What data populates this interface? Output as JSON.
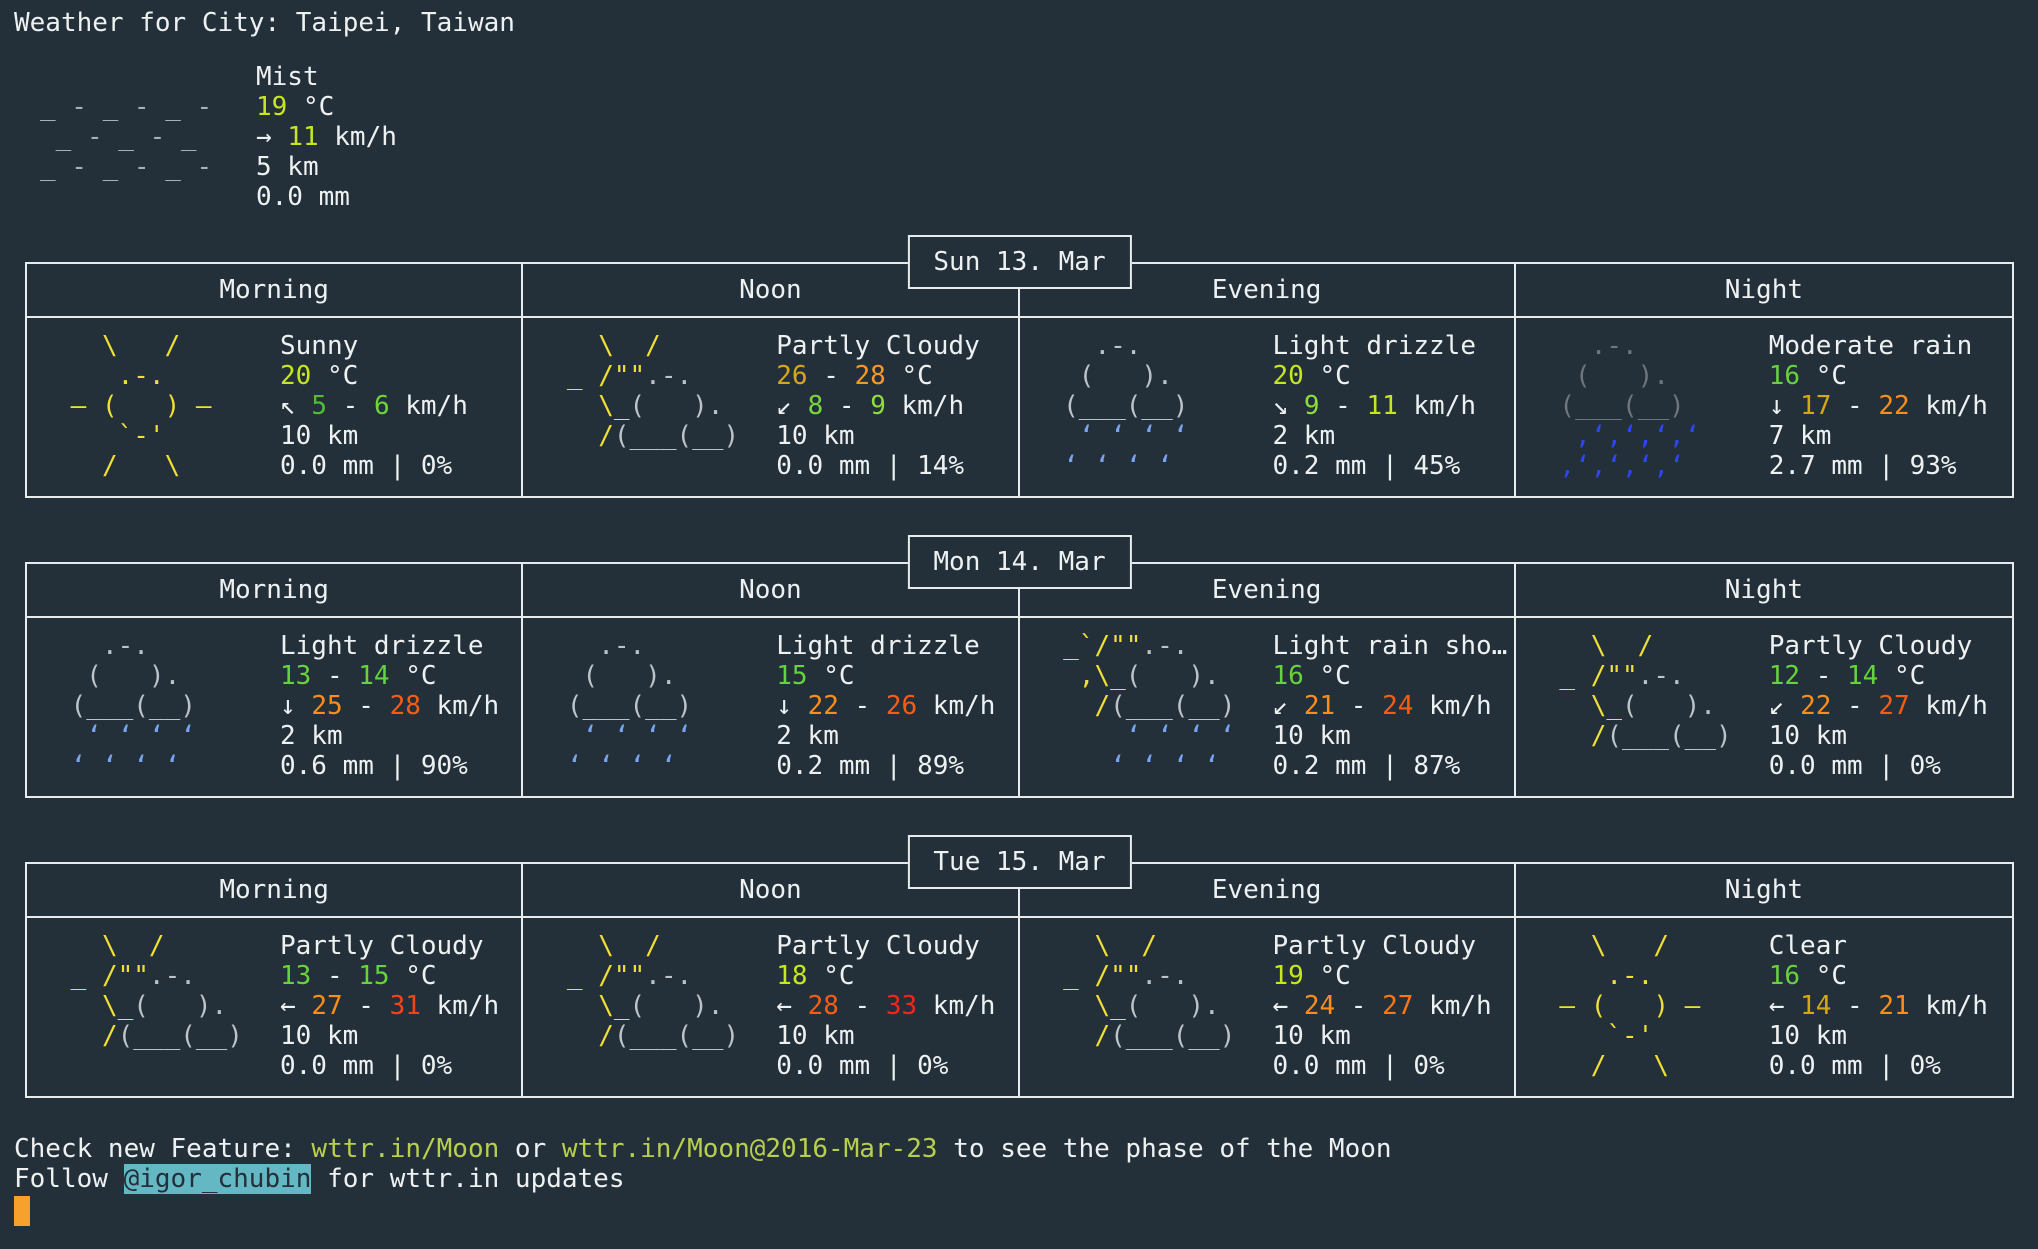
{
  "palette": {
    "background": "#243039",
    "foreground": "#eef1f2",
    "border": "#e8ebec",
    "sun_yellow": "#f0df36",
    "cloud_gray": "#bdc4c8",
    "dark_cloud_gray": "#6e767c",
    "drizzle_blue": "#7aa4f0",
    "rain_blue": "#2c47ef",
    "mist_gray": "#a9b0b5",
    "link_green": "#b8cf4e",
    "handle_background": "#63b8c4",
    "cursor_orange": "#f7a02b"
  },
  "header": {
    "title": "Weather for City: Taipei, Taiwan"
  },
  "current": {
    "icon": "mist",
    "condition": "Mist",
    "temp": {
      "low": {
        "value": "19",
        "color": "#c6e71f"
      },
      "unit": "°C"
    },
    "wind": {
      "arrow": "→",
      "low": {
        "value": "11",
        "color": "#c6e71f"
      },
      "unit": "km/h"
    },
    "visibility": "5 km",
    "precipitation": "0.0 mm"
  },
  "columns": [
    "Morning",
    "Noon",
    "Evening",
    "Night"
  ],
  "days": [
    {
      "label": "Sun 13. Mar",
      "cells": [
        {
          "condition": "Sunny",
          "icon": "sunny",
          "temp": {
            "low": {
              "value": "20",
              "color": "#c6e71f"
            },
            "unit": "°C"
          },
          "wind": {
            "arrow": "↖",
            "low": {
              "value": "5",
              "color": "#4fbe34"
            },
            "high": {
              "value": "6",
              "color": "#6fd53a"
            },
            "unit": "km/h"
          },
          "visibility": "10 km",
          "precipitation": "0.0 mm",
          "chance": "0%"
        },
        {
          "condition": "Partly Cloudy",
          "icon": "partly-cloudy",
          "temp": {
            "low": {
              "value": "26",
              "color": "#d7a61c"
            },
            "high": {
              "value": "28",
              "color": "#f79726"
            },
            "unit": "°C"
          },
          "wind": {
            "arrow": "↙",
            "low": {
              "value": "8",
              "color": "#78d63c"
            },
            "high": {
              "value": "9",
              "color": "#8edc3e"
            },
            "unit": "km/h"
          },
          "visibility": "10 km",
          "precipitation": "0.0 mm",
          "chance": "14%"
        },
        {
          "condition": "Light drizzle",
          "icon": "light-drizzle",
          "temp": {
            "low": {
              "value": "20",
              "color": "#c6e71f"
            },
            "unit": "°C"
          },
          "wind": {
            "arrow": "↘",
            "low": {
              "value": "9",
              "color": "#8edc3e"
            },
            "high": {
              "value": "11",
              "color": "#c6e71f"
            },
            "unit": "km/h"
          },
          "visibility": "2 km",
          "precipitation": "0.2 mm",
          "chance": "45%"
        },
        {
          "condition": "Moderate rain",
          "icon": "moderate-rain",
          "temp": {
            "low": {
              "value": "16",
              "color": "#66d33c"
            },
            "unit": "°C"
          },
          "wind": {
            "arrow": "↓",
            "low": {
              "value": "17",
              "color": "#d2a813"
            },
            "high": {
              "value": "22",
              "color": "#f98e1b"
            },
            "unit": "km/h"
          },
          "visibility": "7 km",
          "precipitation": "2.7 mm",
          "chance": "93%"
        }
      ]
    },
    {
      "label": "Mon 14. Mar",
      "cells": [
        {
          "condition": "Light drizzle",
          "icon": "light-drizzle",
          "temp": {
            "low": {
              "value": "13",
              "color": "#66d33c"
            },
            "high": {
              "value": "14",
              "color": "#66d33c"
            },
            "unit": "°C"
          },
          "wind": {
            "arrow": "↓",
            "low": {
              "value": "25",
              "color": "#f98e1b"
            },
            "high": {
              "value": "28",
              "color": "#f75c14"
            },
            "unit": "km/h"
          },
          "visibility": "2 km",
          "precipitation": "0.6 mm",
          "chance": "90%"
        },
        {
          "condition": "Light drizzle",
          "icon": "light-drizzle",
          "temp": {
            "low": {
              "value": "15",
              "color": "#66d33c"
            },
            "unit": "°C"
          },
          "wind": {
            "arrow": "↓",
            "low": {
              "value": "22",
              "color": "#f98e1b"
            },
            "high": {
              "value": "26",
              "color": "#f75c14"
            },
            "unit": "km/h"
          },
          "visibility": "2 km",
          "precipitation": "0.2 mm",
          "chance": "89%"
        },
        {
          "condition": "Light rain sho…",
          "icon": "light-rain-shower",
          "temp": {
            "low": {
              "value": "16",
              "color": "#66d33c"
            },
            "unit": "°C"
          },
          "wind": {
            "arrow": "↙",
            "low": {
              "value": "21",
              "color": "#f98e1b"
            },
            "high": {
              "value": "24",
              "color": "#f75c14"
            },
            "unit": "km/h"
          },
          "visibility": "10 km",
          "precipitation": "0.2 mm",
          "chance": "87%"
        },
        {
          "condition": "Partly Cloudy",
          "icon": "partly-cloudy",
          "temp": {
            "low": {
              "value": "12",
              "color": "#66d33c"
            },
            "high": {
              "value": "14",
              "color": "#66d33c"
            },
            "unit": "°C"
          },
          "wind": {
            "arrow": "↙",
            "low": {
              "value": "22",
              "color": "#f98e1b"
            },
            "high": {
              "value": "27",
              "color": "#f75c14"
            },
            "unit": "km/h"
          },
          "visibility": "10 km",
          "precipitation": "0.0 mm",
          "chance": "0%"
        }
      ]
    },
    {
      "label": "Tue 15. Mar",
      "cells": [
        {
          "condition": "Partly Cloudy",
          "icon": "partly-cloudy",
          "temp": {
            "low": {
              "value": "13",
              "color": "#66d33c"
            },
            "high": {
              "value": "15",
              "color": "#66d33c"
            },
            "unit": "°C"
          },
          "wind": {
            "arrow": "←",
            "low": {
              "value": "27",
              "color": "#f98e1b"
            },
            "high": {
              "value": "31",
              "color": "#f7431c"
            },
            "unit": "km/h"
          },
          "visibility": "10 km",
          "precipitation": "0.0 mm",
          "chance": "0%"
        },
        {
          "condition": "Partly Cloudy",
          "icon": "partly-cloudy",
          "temp": {
            "low": {
              "value": "18",
              "color": "#c6e71f"
            },
            "unit": "°C"
          },
          "wind": {
            "arrow": "←",
            "low": {
              "value": "28",
              "color": "#f75c14"
            },
            "high": {
              "value": "33",
              "color": "#f7231c"
            },
            "unit": "km/h"
          },
          "visibility": "10 km",
          "precipitation": "0.0 mm",
          "chance": "0%"
        },
        {
          "condition": "Partly Cloudy",
          "icon": "partly-cloudy",
          "temp": {
            "low": {
              "value": "19",
              "color": "#c6e71f"
            },
            "unit": "°C"
          },
          "wind": {
            "arrow": "←",
            "low": {
              "value": "24",
              "color": "#f98e1b"
            },
            "high": {
              "value": "27",
              "color": "#f77716"
            },
            "unit": "km/h"
          },
          "visibility": "10 km",
          "precipitation": "0.0 mm",
          "chance": "0%"
        },
        {
          "condition": "Clear",
          "icon": "clear",
          "temp": {
            "low": {
              "value": "16",
              "color": "#66d33c"
            },
            "unit": "°C"
          },
          "wind": {
            "arrow": "←",
            "low": {
              "value": "14",
              "color": "#d2a813"
            },
            "high": {
              "value": "21",
              "color": "#f98e1b"
            },
            "unit": "km/h"
          },
          "visibility": "10 km",
          "precipitation": "0.0 mm",
          "chance": "0%"
        }
      ]
    }
  ],
  "footer": {
    "check_prefix": "Check new Feature: ",
    "link1": "wttr.in/Moon",
    "middle": " or ",
    "link2": "wttr.in/Moon@2016-Mar-23",
    "suffix": " to see the phase of the Moon",
    "follow_prefix": "Follow ",
    "handle": "@igor_chubin",
    "follow_suffix": " for wttr.in updates"
  }
}
